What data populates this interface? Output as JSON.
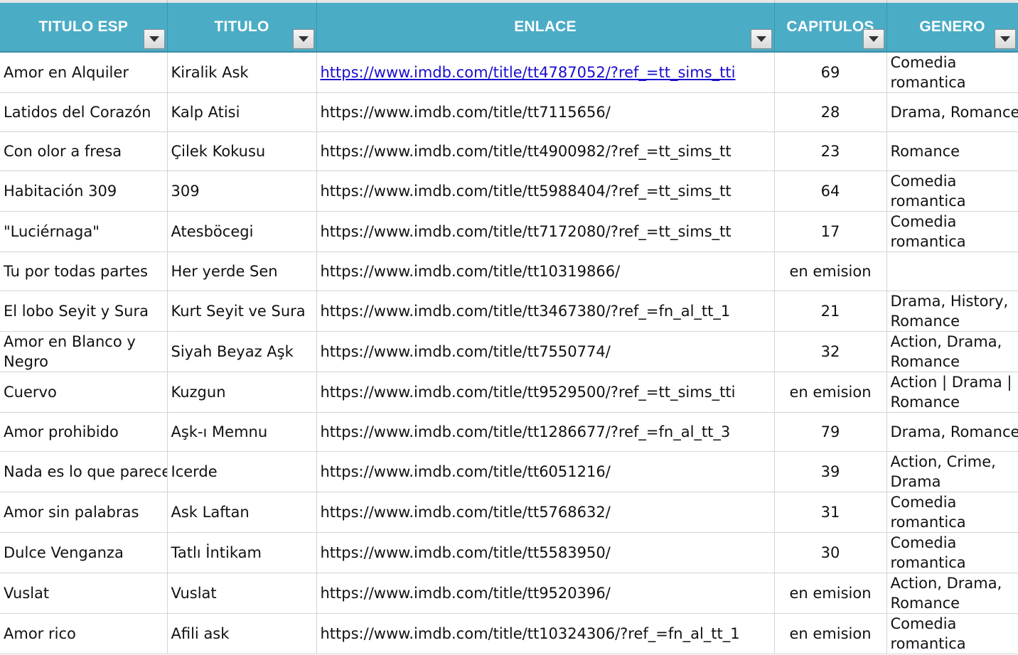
{
  "columns": [
    {
      "label": "TITULO ESP"
    },
    {
      "label": "TITULO"
    },
    {
      "label": "ENLACE"
    },
    {
      "label": "CAPITULOS"
    },
    {
      "label": "GENERO"
    }
  ],
  "rows": [
    {
      "esp": "Amor en Alquiler",
      "titulo": "Kiralik Ask",
      "enlace": "https://www.imdb.com/title/tt4787052/?ref_=tt_sims_tti",
      "capitulos": "69",
      "genero": "Comedia romantica"
    },
    {
      "esp": "Latidos del Corazón",
      "titulo": "Kalp Atisi",
      "enlace": "https://www.imdb.com/title/tt7115656/",
      "capitulos": "28",
      "genero": "Drama, Romance"
    },
    {
      "esp": "Con olor a fresa",
      "titulo": "Çilek Kokusu",
      "enlace": "https://www.imdb.com/title/tt4900982/?ref_=tt_sims_tt",
      "capitulos": "23",
      "genero": "Romance"
    },
    {
      "esp": "Habitación 309",
      "titulo": "309",
      "enlace": "https://www.imdb.com/title/tt5988404/?ref_=tt_sims_tt",
      "capitulos": "64",
      "genero": "Comedia romantica"
    },
    {
      "esp": "\"Luciérnaga\"",
      "titulo": "Atesböcegi",
      "enlace": "https://www.imdb.com/title/tt7172080/?ref_=tt_sims_tt",
      "capitulos": "17",
      "genero": "Comedia romantica"
    },
    {
      "esp": "Tu por todas partes",
      "titulo": "Her yerde Sen",
      "enlace": "https://www.imdb.com/title/tt10319866/",
      "capitulos": "en emision",
      "genero": ""
    },
    {
      "esp": "El lobo Seyit y Sura",
      "titulo": "Kurt Seyit ve Sura",
      "enlace": "https://www.imdb.com/title/tt3467380/?ref_=fn_al_tt_1",
      "capitulos": "21",
      "genero": "Drama, History, Romance"
    },
    {
      "esp": "Amor en Blanco y Negro",
      "titulo": "Siyah Beyaz Aşk",
      "enlace": "https://www.imdb.com/title/tt7550774/",
      "capitulos": "32",
      "genero": "Action, Drama, Romance"
    },
    {
      "esp": "Cuervo",
      "titulo": "Kuzgun",
      "enlace": "https://www.imdb.com/title/tt9529500/?ref_=tt_sims_tti",
      "capitulos": "en emision",
      "genero": "Action | Drama | Romance"
    },
    {
      "esp": "Amor prohibido",
      "titulo": "Aşk-ı Memnu",
      "enlace": "https://www.imdb.com/title/tt1286677/?ref_=fn_al_tt_3",
      "capitulos": "79",
      "genero": "Drama, Romance"
    },
    {
      "esp": "Nada es lo que parece",
      "titulo": "Icerde",
      "enlace": "https://www.imdb.com/title/tt6051216/",
      "capitulos": "39",
      "genero": "Action, Crime, Drama"
    },
    {
      "esp": "Amor sin palabras",
      "titulo": "Ask Laftan",
      "enlace": "https://www.imdb.com/title/tt5768632/",
      "capitulos": "31",
      "genero": "Comedia romantica"
    },
    {
      "esp": "Dulce Venganza",
      "titulo": "Tatlı İntikam",
      "enlace": "https://www.imdb.com/title/tt5583950/",
      "capitulos": "30",
      "genero": "Comedia romantica"
    },
    {
      "esp": "Vuslat",
      "titulo": "Vuslat",
      "enlace": "https://www.imdb.com/title/tt9520396/",
      "capitulos": "en emision",
      "genero": "Action, Drama, Romance"
    },
    {
      "esp": "Amor rico",
      "titulo": "Afili ask",
      "enlace": "https://www.imdb.com/title/tt10324306/?ref_=fn_al_tt_1",
      "capitulos": "en emision",
      "genero": "Comedia romantica"
    }
  ],
  "link_color": "#1a0dcc",
  "header_color": "#4bacc6",
  "filter_icon": "dropdown-arrow-icon"
}
